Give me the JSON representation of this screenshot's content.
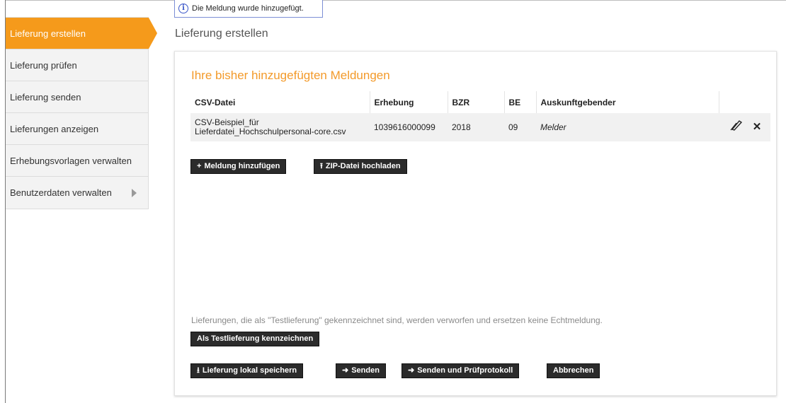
{
  "notice": {
    "text": "Die Meldung wurde hinzugefügt."
  },
  "sidebar": {
    "items": [
      {
        "label": "Lieferung erstellen"
      },
      {
        "label": "Lieferung prüfen"
      },
      {
        "label": "Lieferung senden"
      },
      {
        "label": "Lieferungen anzeigen"
      },
      {
        "label": "Erhebungsvorlagen verwalten"
      },
      {
        "label": "Benutzerdaten verwalten"
      }
    ]
  },
  "page": {
    "title": "Lieferung erstellen"
  },
  "panel": {
    "section_title": "Ihre bisher hinzugefügten Meldungen",
    "table": {
      "headers": [
        "CSV-Datei",
        "Erhebung",
        "BZR",
        "BE",
        "Auskunftgebender"
      ],
      "rows": [
        {
          "csv_line1": "CSV-Beispiel_für",
          "csv_line2": "Lieferdatei_Hochschulpersonal-core.csv",
          "erhebung": "1039616000099",
          "bzr": "2018",
          "be": "09",
          "auskunftgebender": "Melder"
        }
      ]
    },
    "buttons": {
      "add_report": "Meldung hinzufügen",
      "upload_zip": "ZIP-Datei hochladen",
      "mark_test": "Als Testlieferung kennzeichnen",
      "save_local": "Lieferung lokal speichern",
      "send": "Senden",
      "send_protocol": "Senden und Prüfprotokoll",
      "cancel": "Abbrechen"
    },
    "info_text": "Lieferungen, die als \"Testlieferung\" gekennzeichnet sind, werden verworfen und ersetzen keine Echtmeldung."
  },
  "colors": {
    "accent": "#f59a1b",
    "title_orange": "#f39a2a",
    "button_dark": "#2b2b2b",
    "notice_border": "#7c8fd6"
  },
  "icons": {
    "info": "info-icon",
    "edit": "pencil-icon",
    "delete": "close-icon",
    "plus": "plus-icon",
    "upload": "upload-icon",
    "download": "download-icon",
    "arrow_right": "arrow-right-icon",
    "submenu": "chevron-right-icon"
  }
}
